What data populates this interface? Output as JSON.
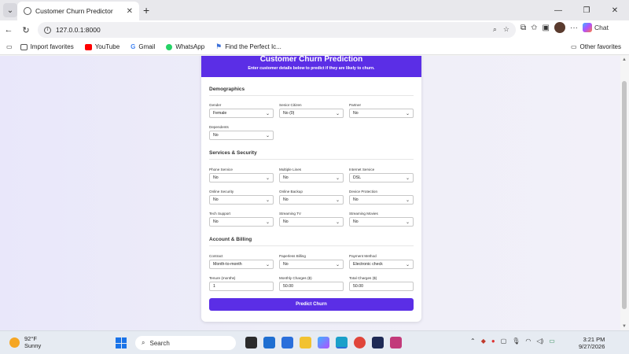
{
  "browser": {
    "tab_title": "Customer Churn Predictor",
    "url": "127.0.0.1:8000",
    "copilot_label": "Chat",
    "favorites": [
      {
        "label": "Import favorites",
        "icon": "import-icon",
        "color": "#555555"
      },
      {
        "label": "YouTube",
        "icon": "youtube-icon",
        "color": "#ff0000"
      },
      {
        "label": "Gmail",
        "icon": "google-icon",
        "color": "#4285f4"
      },
      {
        "label": "WhatsApp",
        "icon": "whatsapp-icon",
        "color": "#25d366"
      },
      {
        "label": "Find the Perfect Ic...",
        "icon": "flag-icon",
        "color": "#3b6fd8"
      }
    ],
    "other_favorites": "Other favorites"
  },
  "form": {
    "title": "Customer Churn Prediction",
    "subtitle": "Enter customer details below to predict if they are likely to churn.",
    "sections": {
      "demographics": "Demographics",
      "services": "Services & Security",
      "account": "Account & Billing"
    },
    "fields": {
      "gender": {
        "label": "Gender",
        "value": "Female"
      },
      "senior": {
        "label": "Senior Citizen",
        "value": "No (0)"
      },
      "partner": {
        "label": "Partner",
        "value": "No"
      },
      "dependents": {
        "label": "Dependents",
        "value": "No"
      },
      "phone": {
        "label": "Phone Service",
        "value": "No"
      },
      "multiple": {
        "label": "Multiple Lines",
        "value": "No"
      },
      "internet": {
        "label": "Internet Service",
        "value": "DSL"
      },
      "security": {
        "label": "Online Security",
        "value": "No"
      },
      "backup": {
        "label": "Online Backup",
        "value": "No"
      },
      "protection": {
        "label": "Device Protection",
        "value": "No"
      },
      "support": {
        "label": "Tech Support",
        "value": "No"
      },
      "tv": {
        "label": "Streaming TV",
        "value": "No"
      },
      "movies": {
        "label": "Streaming Movies",
        "value": "No"
      },
      "contract": {
        "label": "Contract",
        "value": "Month-to-month"
      },
      "paperless": {
        "label": "Paperless Billing",
        "value": "No"
      },
      "payment": {
        "label": "Payment Method",
        "value": "Electronic check"
      },
      "tenure": {
        "label": "Tenure (months)",
        "value": "1"
      },
      "monthly": {
        "label": "Monthly Charges ($)",
        "value": "50.00"
      },
      "total": {
        "label": "Total Charges ($)",
        "value": "50.00"
      }
    },
    "submit_label": "Predict Churn",
    "accent": "#5b2ee6"
  },
  "taskbar": {
    "temperature": "92°F",
    "condition": "Sunny",
    "search_label": "Search",
    "time": "3:21 PM",
    "date": "9/27/2026"
  }
}
